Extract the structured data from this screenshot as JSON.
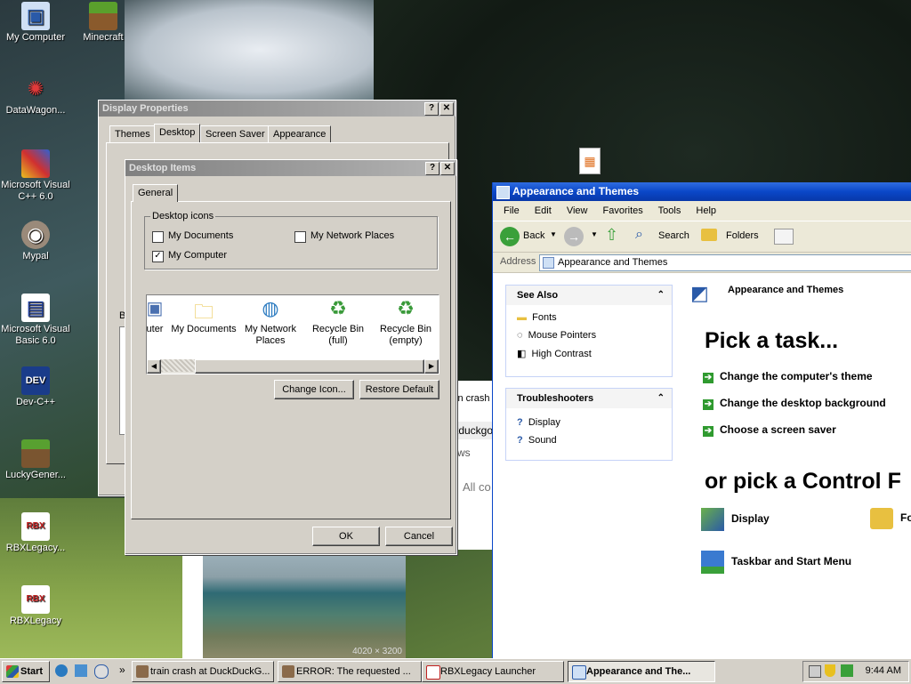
{
  "desktop": {
    "icons": [
      {
        "label": "My Computer",
        "icon": "my-computer-icon"
      },
      {
        "label": "Minecraft",
        "icon": "minecraft-icon"
      },
      {
        "label": "DataWagon...",
        "icon": "datawagon-icon"
      },
      {
        "label": "Microsoft Visual C++ 6.0",
        "icon": "visual-cpp-icon"
      },
      {
        "label": "Mypal",
        "icon": "mypal-icon"
      },
      {
        "label": "Microsoft Visual Basic 6.0",
        "icon": "visual-basic-icon"
      },
      {
        "label": "Dev-C++",
        "icon": "dev-cpp-icon"
      },
      {
        "label": "LuckyGener...",
        "icon": "lucky-generator-icon"
      },
      {
        "label": "RBXLegacy...",
        "icon": "rbxlegacy-icon"
      },
      {
        "label": "RBXLegacy",
        "icon": "rbxlegacy-icon"
      }
    ],
    "photo_caption": "4020 × 3200"
  },
  "display_properties": {
    "title": "Display Properties",
    "tabs": [
      "Themes",
      "Desktop",
      "Screen Saver",
      "Appearance"
    ],
    "active_tab": "Desktop",
    "partial_label": "B"
  },
  "desktop_items": {
    "title": "Desktop Items",
    "tab": "General",
    "group_label": "Desktop icons",
    "checkboxes": [
      {
        "label": "My Documents",
        "checked": false
      },
      {
        "label": "My Network Places",
        "checked": false
      },
      {
        "label": "My Computer",
        "checked": true
      }
    ],
    "icon_list": [
      {
        "label": "uter",
        "icon": "my-computer-icon"
      },
      {
        "label": "My Documents",
        "icon": "my-documents-icon"
      },
      {
        "label": "My Network Places",
        "icon": "network-places-icon"
      },
      {
        "label": "Recycle Bin (full)",
        "icon": "recycle-bin-full-icon"
      },
      {
        "label": "Recycle Bin (empty)",
        "icon": "recycle-bin-empty-icon"
      }
    ],
    "change_icon_button": "Change Icon...",
    "restore_default_button": "Restore Default",
    "ok_button": "OK",
    "cancel_button": "Cancel"
  },
  "background_browser": {
    "tab_text": "in crash",
    "address_text": "tduckgo",
    "nav_text": "ws",
    "filter_text": "All co"
  },
  "explorer": {
    "title": "Appearance and Themes",
    "menu": [
      "File",
      "Edit",
      "View",
      "Favorites",
      "Tools",
      "Help"
    ],
    "toolbar": {
      "back": "Back",
      "search": "Search",
      "folders": "Folders"
    },
    "address_label": "Address",
    "address_value": "Appearance and Themes",
    "see_also": {
      "title": "See Also",
      "items": [
        "Fonts",
        "Mouse Pointers",
        "High Contrast"
      ]
    },
    "troubleshooters": {
      "title": "Troubleshooters",
      "items": [
        "Display",
        "Sound"
      ]
    },
    "header_title": "Appearance and Themes",
    "pick_task": "Pick a task...",
    "tasks": [
      "Change the computer's theme",
      "Change the desktop background",
      "Choose a screen saver"
    ],
    "pick_control": "or pick a Control F",
    "control_icons": [
      "Display",
      "Fo",
      "Taskbar and Start Menu"
    ]
  },
  "taskbar": {
    "start": "Start",
    "buttons": [
      "train crash at DuckDuckG...",
      "ERROR: The requested ...",
      "RBXLegacy Launcher",
      "Appearance and The..."
    ],
    "quicklaunch_chevron": "»",
    "clock": "9:44 AM"
  },
  "colors": {
    "xp_blue": "#0a47c8",
    "inactive_title": "#808080",
    "window_face": "#d4d0c8",
    "task_arrow_green": "#2f9a2f"
  }
}
